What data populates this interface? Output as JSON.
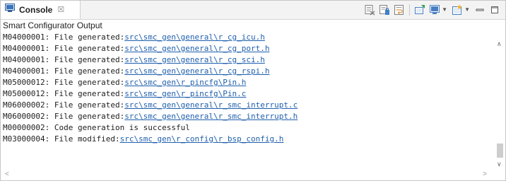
{
  "tab": {
    "icon": "console-icon",
    "label": "Console",
    "close": "☒"
  },
  "toolbar": {
    "icons": [
      "clear-console-icon",
      "scroll-lock-icon",
      "word-wrap-icon",
      "pin-console-icon",
      "display-console-icon",
      "open-console-icon",
      "minimize-icon",
      "maximize-icon"
    ]
  },
  "console_title": "Smart Configurator Output",
  "lines": [
    {
      "prefix": "M04000001: File generated:",
      "link": "src\\smc_gen\\general\\r_cg_icu.h"
    },
    {
      "prefix": "M04000001: File generated:",
      "link": "src\\smc_gen\\general\\r_cg_port.h"
    },
    {
      "prefix": "M04000001: File generated:",
      "link": "src\\smc_gen\\general\\r_cg_sci.h"
    },
    {
      "prefix": "M04000001: File generated:",
      "link": "src\\smc_gen\\general\\r_cg_rspi.h"
    },
    {
      "prefix": "M05000012: File generated:",
      "link": "src\\smc_gen\\r_pincfg\\Pin.h"
    },
    {
      "prefix": "M05000012: File generated:",
      "link": "src\\smc_gen\\r_pincfg\\Pin.c"
    },
    {
      "prefix": "M06000002: File generated:",
      "link": "src\\smc_gen\\general\\r_smc_interrupt.c"
    },
    {
      "prefix": "M06000002: File generated:",
      "link": "src\\smc_gen\\general\\r_smc_interrupt.h"
    },
    {
      "prefix": "M00000002: Code generation is successful",
      "link": ""
    },
    {
      "prefix": "M03000004: File modified:",
      "link": "src\\smc_gen\\r_config\\r_bsp_config.h"
    }
  ],
  "colors": {
    "link": "#1f5fae",
    "text": "#1e1e1e",
    "tab_bar": "#f3f3f3"
  }
}
